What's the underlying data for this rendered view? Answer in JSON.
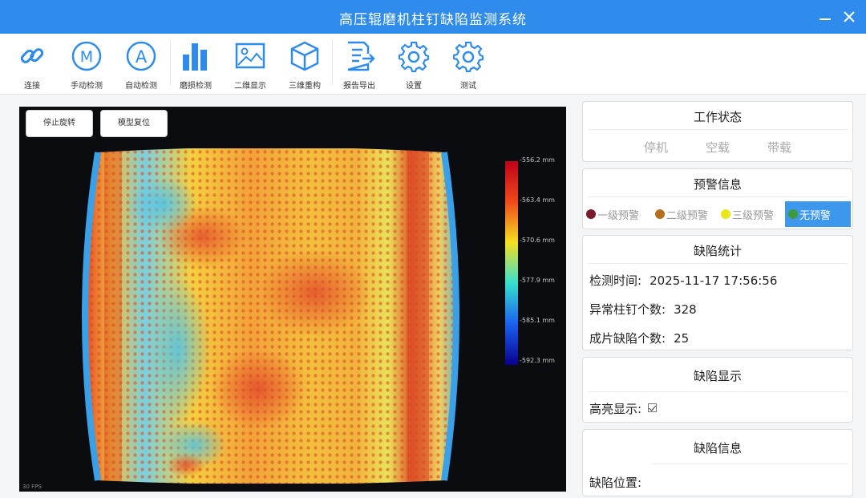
{
  "window": {
    "title": "高压辊磨机柱钉缺陷监测系统"
  },
  "toolbar": {
    "connect": "连接",
    "manual": "手动检测",
    "auto": "自动检测",
    "wear": "磨损检测",
    "view2d": "二维显示",
    "view3d": "三维重构",
    "report": "报告导出",
    "settings": "设置",
    "test": "测试"
  },
  "viewer": {
    "stop_rotate": "停止旋转",
    "reset_model": "模型复位",
    "colorbar_ticks": [
      "-556.2 mm",
      "-563.4 mm",
      "-570.6 mm",
      "-577.9 mm",
      "-585.1 mm",
      "-592.3 mm"
    ],
    "fps_text": "30 FPS"
  },
  "work_status": {
    "title": "工作状态",
    "states": [
      "停机",
      "空载",
      "带载"
    ]
  },
  "warning": {
    "title": "预警信息",
    "levels": [
      {
        "label": "一级预警",
        "color": "#7a1a2a"
      },
      {
        "label": "二级预警",
        "color": "#b5701f"
      },
      {
        "label": "三级预警",
        "color": "#e9e61a"
      },
      {
        "label": "无预警",
        "color": "#3f9a3c"
      }
    ],
    "active": "无预警"
  },
  "defect_stats": {
    "title": "缺陷统计",
    "detect_time_label": "检测时间:",
    "detect_time": "2025-11-17 17:56:56",
    "abnormal_label": "异常柱钉个数:",
    "abnormal_count": "328",
    "cluster_label": "成片缺陷个数:",
    "cluster_count": "25"
  },
  "defect_display": {
    "title": "缺陷显示",
    "highlight_label": "高亮显示:",
    "highlight_checked": true
  },
  "defect_info": {
    "title": "缺陷信息",
    "position_label": "缺陷位置:"
  }
}
